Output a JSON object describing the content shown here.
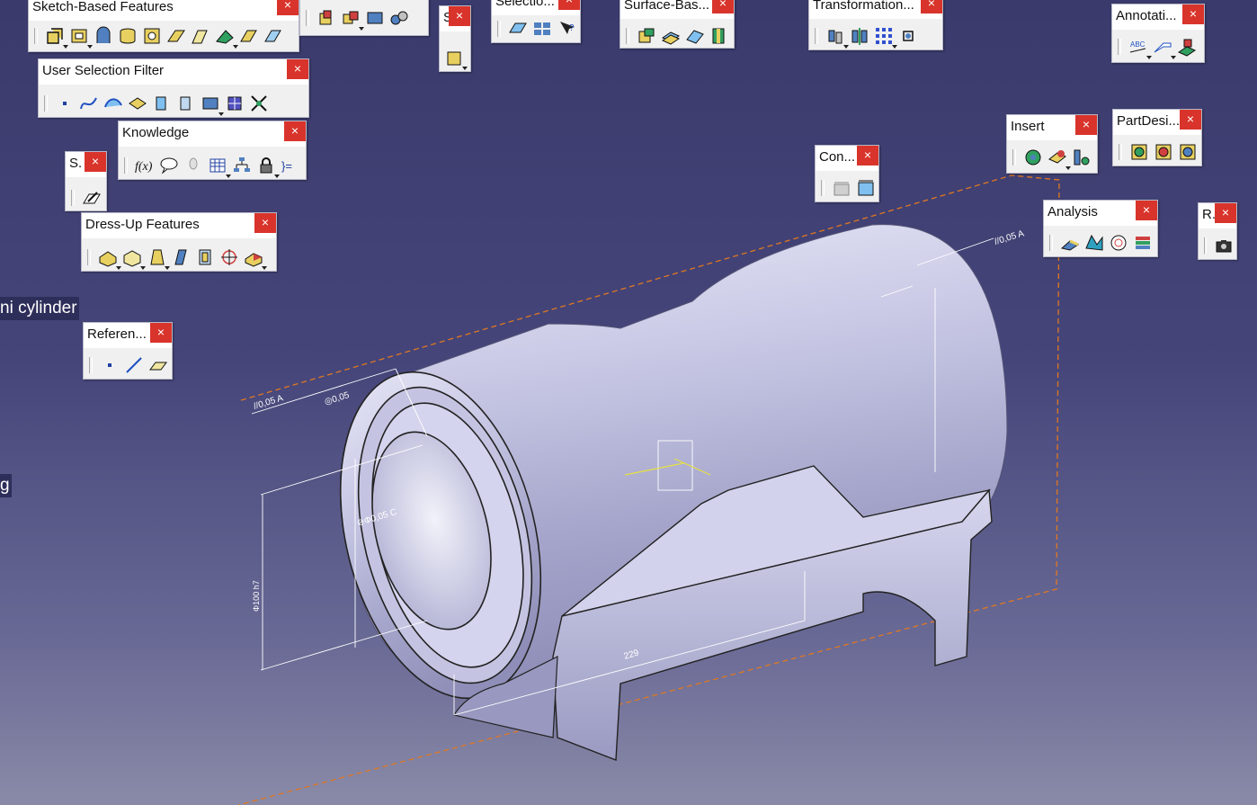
{
  "toolbars": {
    "sketch": {
      "title": "Sketch-Based Features"
    },
    "unnamed1": {
      "title": ""
    },
    "s_small": {
      "title": "S"
    },
    "selection": {
      "title": "Selectio..."
    },
    "surface": {
      "title": "Surface-Bas..."
    },
    "transform": {
      "title": "Transformation..."
    },
    "annot": {
      "title": "Annotati..."
    },
    "usf": {
      "title": "User Selection Filter"
    },
    "knowledge": {
      "title": "Knowledge"
    },
    "s2": {
      "title": "S."
    },
    "dressup": {
      "title": "Dress-Up Features"
    },
    "reference": {
      "title": "Referen..."
    },
    "insert": {
      "title": "Insert"
    },
    "partdesign": {
      "title": "PartDesi..."
    },
    "con": {
      "title": "Con..."
    },
    "analysis": {
      "title": "Analysis"
    },
    "r": {
      "title": "R."
    }
  },
  "side_labels": {
    "cylinder": "ni cylinder",
    "g": "g"
  },
  "dimensions": {
    "tol1": "//0,05 A",
    "tol2": "◎0,05",
    "tol3": "//0,05 A",
    "dia": "⊘Φ0,05 C",
    "len": "229",
    "vert": "Φ100 h7"
  },
  "colors": {
    "bg": "#3a3a6c",
    "close": "#d9342b",
    "part": "#c8c8e8",
    "dim": "#ffffff",
    "box": "#e07820"
  }
}
